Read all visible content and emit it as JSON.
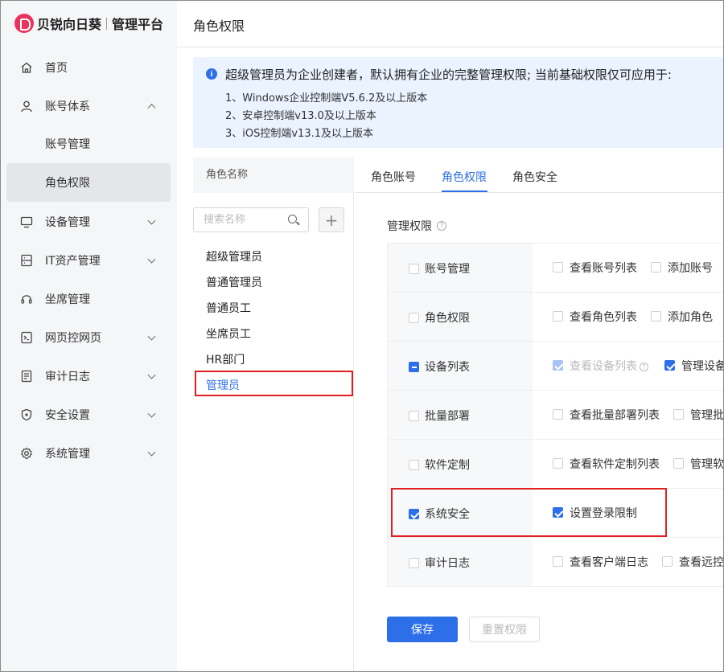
{
  "app": {
    "brand": "贝锐向日葵",
    "subtitle": "管理平台"
  },
  "sidebar": {
    "items": [
      {
        "label": "首页",
        "icon": "home-icon"
      },
      {
        "label": "账号体系",
        "icon": "user-icon",
        "expanded": true
      },
      {
        "label": "账号管理",
        "sub": true
      },
      {
        "label": "角色权限",
        "sub": true,
        "active": true
      },
      {
        "label": "设备管理",
        "icon": "monitor-icon"
      },
      {
        "label": "IT资产管理",
        "icon": "asset-icon"
      },
      {
        "label": "坐席管理",
        "icon": "headset-icon"
      },
      {
        "label": "网页控网页",
        "icon": "web-icon"
      },
      {
        "label": "审计日志",
        "icon": "log-icon"
      },
      {
        "label": "安全设置",
        "icon": "shield-icon"
      },
      {
        "label": "系统管理",
        "icon": "gear-icon"
      }
    ]
  },
  "header": {
    "title": "角色权限"
  },
  "notice": {
    "title": "超级管理员为企业创建者，默认拥有企业的完整管理权限; 当前基础权限仅可应用于:",
    "lines": [
      "1、Windows企业控制端V5.6.2及以上版本",
      "2、安卓控制端v13.0及以上版本",
      "3、iOS控制端v13.1及以上版本"
    ]
  },
  "roles": {
    "header": "角色名称",
    "search_placeholder": "搜索名称",
    "add_label": "+",
    "items": [
      "超级管理员",
      "普通管理员",
      "普通员工",
      "坐席员工",
      "HR部门",
      "管理员"
    ],
    "selected_index": 5
  },
  "tabs": [
    {
      "label": "角色账号"
    },
    {
      "label": "角色权限",
      "active": true
    },
    {
      "label": "角色安全"
    }
  ],
  "permissions": {
    "label": "管理权限",
    "help": "?",
    "rows": [
      {
        "name": "账号管理",
        "state": "unchecked",
        "options": [
          {
            "label": "查看账号列表",
            "state": "unchecked"
          },
          {
            "label": "添加账号",
            "state": "unchecked"
          }
        ]
      },
      {
        "name": "角色权限",
        "state": "unchecked",
        "options": [
          {
            "label": "查看角色列表",
            "state": "unchecked"
          },
          {
            "label": "添加角色",
            "state": "unchecked"
          }
        ]
      },
      {
        "name": "设备列表",
        "state": "indeterminate",
        "options": [
          {
            "label": "查看设备列表",
            "state": "disabled-checked",
            "help": "?"
          },
          {
            "label": "管理设备",
            "state": "checked"
          }
        ]
      },
      {
        "name": "批量部署",
        "state": "unchecked",
        "options": [
          {
            "label": "查看批量部署列表",
            "state": "unchecked"
          },
          {
            "label": "管理批",
            "state": "unchecked"
          }
        ]
      },
      {
        "name": "软件定制",
        "state": "unchecked",
        "options": [
          {
            "label": "查看软件定制列表",
            "state": "unchecked"
          },
          {
            "label": "管理软",
            "state": "unchecked"
          }
        ]
      },
      {
        "name": "系统安全",
        "state": "checked",
        "options": [
          {
            "label": "设置登录限制",
            "state": "checked"
          }
        ]
      },
      {
        "name": "审计日志",
        "state": "unchecked",
        "options": [
          {
            "label": "查看客户端日志",
            "state": "unchecked"
          },
          {
            "label": "查看远控",
            "state": "unchecked"
          }
        ]
      }
    ]
  },
  "actions": {
    "save": "保存",
    "reset": "重置权限"
  },
  "colors": {
    "accent": "#2d6fe8",
    "brand": "#e8335c",
    "highlight": "#e02020"
  }
}
